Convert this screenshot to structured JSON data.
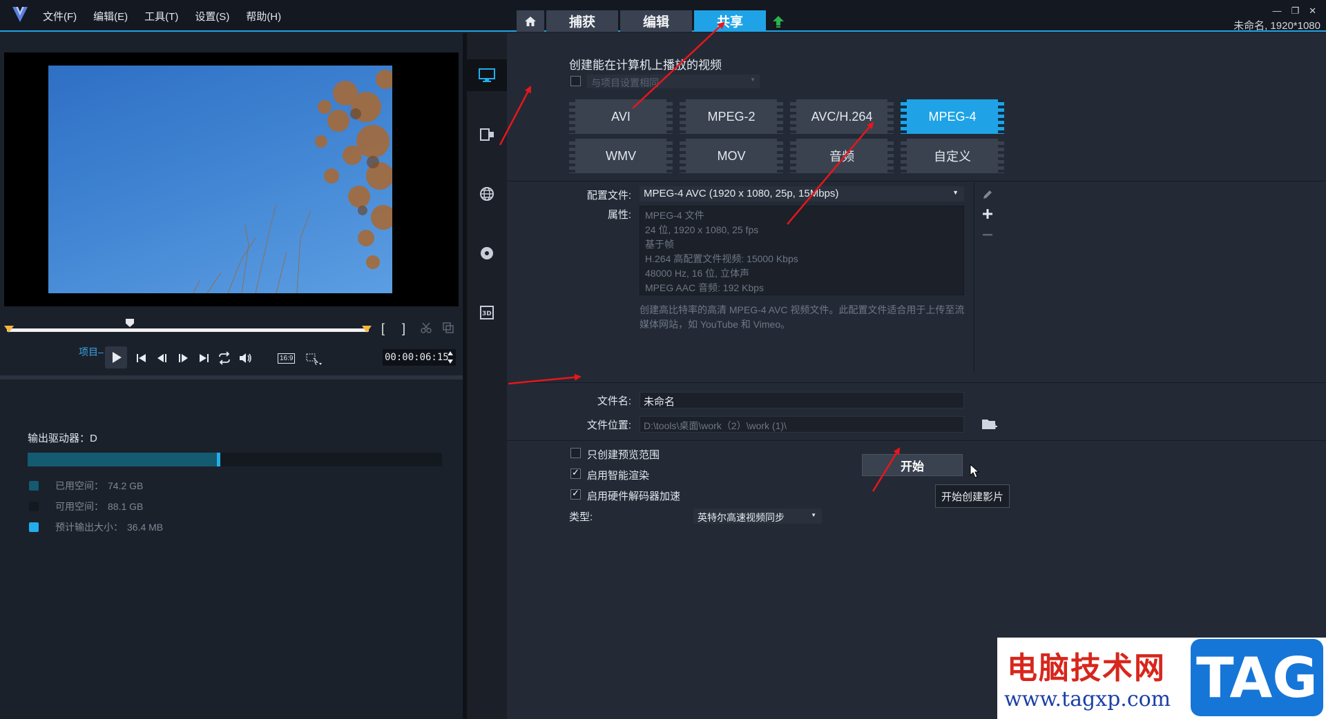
{
  "menu": [
    "文件(F)",
    "编辑(E)",
    "工具(T)",
    "设置(S)",
    "帮助(H)"
  ],
  "mode_tabs": [
    "捕获",
    "编辑",
    "共享"
  ],
  "project_info": "未命名, 1920*1080",
  "player": {
    "project_label": "项目",
    "aspect_label": "16:9",
    "timecode": "00:00:06:15"
  },
  "storage": {
    "drive_label": "输出驱动器：D",
    "used_fraction": 0.457,
    "legend": [
      {
        "label": "已用空间：",
        "value": "74.2 GB",
        "color": "#145a70"
      },
      {
        "label": "可用空间：",
        "value": "88.1 GB",
        "color": "#141920"
      },
      {
        "label": "预计输出大小：",
        "value": "36.4 MB",
        "color": "#22aeea"
      }
    ]
  },
  "share": {
    "heading": "创建能在计算机上播放的视频",
    "same_as_project_label": "与项目设置相同",
    "formats_row1": [
      "AVI",
      "MPEG-2",
      "AVC/H.264",
      "MPEG-4"
    ],
    "formats_row2": [
      "WMV",
      "MOV",
      "音频",
      "自定义"
    ],
    "profile_label": "配置文件:",
    "profile_value": "MPEG-4 AVC (1920 x 1080, 25p, 15Mbps)",
    "properties_label": "属性:",
    "properties": [
      "MPEG-4 文件",
      "24 位, 1920 x 1080, 25 fps",
      "基于帧",
      "H.264 高配置文件视频: 15000 Kbps",
      "48000 Hz, 16 位, 立体声",
      "MPEG AAC 音频: 192 Kbps"
    ],
    "description": "创建高比特率的高清 MPEG-4 AVC 视频文件。此配置文件适合用于上传至流媒体网站，如 YouTube 和 Vimeo。",
    "filename_label": "文件名:",
    "filename_value": "未命名",
    "location_label": "文件位置:",
    "location_value": "D:\\tools\\桌面\\work（2）\\work (1)\\",
    "options": [
      {
        "label": "只创建预览范围",
        "checked": false
      },
      {
        "label": "启用智能渲染",
        "checked": true
      },
      {
        "label": "启用硬件解码器加速",
        "checked": true
      }
    ],
    "type_label": "类型:",
    "type_value": "英特尔高速视频同步",
    "start_label": "开始",
    "start_tooltip": "开始创建影片"
  },
  "watermark": {
    "cn": "电脑技术网",
    "url": "www.tagxp.com",
    "tag": "TAG"
  }
}
